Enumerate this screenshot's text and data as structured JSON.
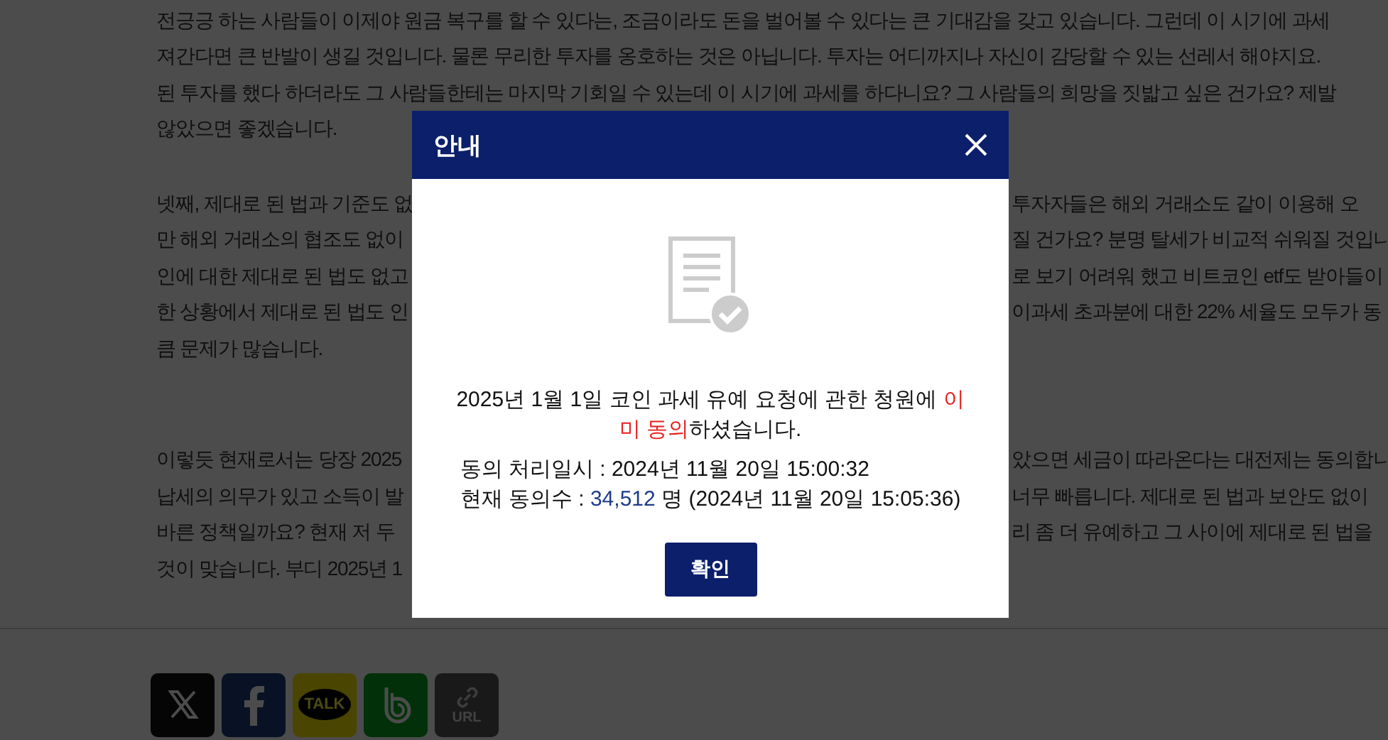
{
  "article": {
    "paragraphs": [
      {
        "lines": [
          {
            "kind": "full",
            "text": "전긍긍 하는 사람들이 이제야 원금 복구를 할 수 있다는, 조금이라도 돈을 벌어볼 수 있다는 큰 기대감을 갖고 있습니다. 그런데 이 시기에 과세"
          },
          {
            "kind": "full",
            "text": "져간다면 큰 반발이 생길 것입니다. 물론 무리한 투자를 옹호하는 것은 아닙니다. 투자는 어디까지나 자신이 감당할 수 있는 선레서 해야지요."
          },
          {
            "kind": "full",
            "text": "된 투자를 했다 하더라도 그 사람들한테는 마지막 기회일 수 있는데 이 시기에 과세를 하다니요? 그 사람들의 희망을 짓밟고 싶은 건가요? 제발"
          },
          {
            "kind": "full",
            "text": "않았으면 좋겠습니다."
          }
        ]
      },
      {
        "lines": [
          {
            "kind": "split",
            "left": "넷째, 제대로 된 법과 기준도 없",
            "right": "투자자들은 해외 거래소도 같이 이용해 오"
          },
          {
            "kind": "split",
            "left": "만 해외 거래소의 협조도 없이",
            "right": "질 건가요? 분명 탈세가 비교적 쉬워질 것입니"
          },
          {
            "kind": "split",
            "left": "인에 대한 제대로 된 법도 없고",
            "right": "로 보기 어려워 했고 비트코인 etf도 받아들이"
          },
          {
            "kind": "split",
            "left": "한 상황에서 제대로 된 법도 인",
            "right": "이과세 초과분에 대한 22% 세율도 모두가 동"
          },
          {
            "kind": "full",
            "text": "큼 문제가 많습니다."
          }
        ]
      },
      {
        "lines": [
          {
            "kind": "split",
            "left": "이렇듯 현재로서는 당장 2025",
            "right": "았으면 세금이 따라온다는 대전제는 동의합니"
          },
          {
            "kind": "split",
            "left": "납세의 의무가 있고 소득이 발",
            "right": "너무 빠릅니다. 제대로 된 법과 보안도 없이"
          },
          {
            "kind": "split",
            "left": "바른 정책일까요? 현재 저 두",
            "right": "리 좀 더 유예하고 그 사이에 제대로 된 법을"
          },
          {
            "kind": "full",
            "text": "것이 맞습니다. 부디 2025년 1"
          }
        ]
      }
    ]
  },
  "share_buttons": [
    {
      "kind": "x"
    },
    {
      "kind": "facebook"
    },
    {
      "kind": "kakaotalk",
      "label": "TALK"
    },
    {
      "kind": "band"
    },
    {
      "kind": "url",
      "label": "URL"
    }
  ],
  "modal": {
    "title": "안내",
    "message": "2025년 1월 1일 코인 과세 유예 요청에 관한 청원에 **이미 동의**하셨습니다.",
    "processed": "동의 처리일시 : 2024년 11월 20일 15:00:32",
    "count_label": "현재 동의수 :",
    "count": "34,512",
    "count_suffix": "명 (2024년 11월 20일 15:05:36)",
    "confirm": "확인"
  }
}
